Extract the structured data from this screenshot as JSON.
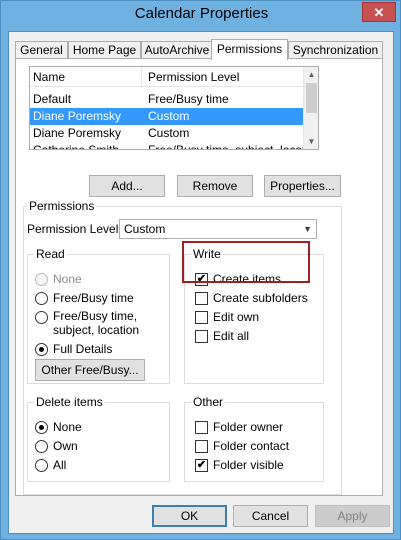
{
  "window": {
    "title": "Calendar Properties",
    "close_glyph": "✕"
  },
  "tabs": [
    "General",
    "Home Page",
    "AutoArchive",
    "Permissions",
    "Synchronization"
  ],
  "active_tab": "Permissions",
  "list": {
    "columns": [
      "Name",
      "Permission Level"
    ],
    "rows": [
      {
        "name": "Default",
        "level": "Free/Busy time"
      },
      {
        "name": "Diane Poremsky",
        "level": "Custom",
        "selected": true
      },
      {
        "name": "Diane Poremsky",
        "level": "Custom"
      },
      {
        "name": "Catherine Smith",
        "level": "Free/Busy time, subject, location"
      }
    ]
  },
  "list_buttons": {
    "add": "Add...",
    "remove": "Remove",
    "properties": "Properties..."
  },
  "permissions": {
    "group_label": "Permissions",
    "level_label": "Permission Level:",
    "level_value": "Custom",
    "read": {
      "label": "Read",
      "options": [
        "None",
        "Free/Busy time",
        "Free/Busy time,",
        "subject, location",
        "Full Details"
      ],
      "selected": "Full Details",
      "other_button": "Other Free/Busy..."
    },
    "write": {
      "label": "Write",
      "items": [
        {
          "label": "Create items",
          "checked": true
        },
        {
          "label": "Create subfolders",
          "checked": false
        },
        {
          "label": "Edit own",
          "checked": false
        },
        {
          "label": "Edit all",
          "checked": false
        }
      ]
    },
    "delete": {
      "label": "Delete items",
      "options": [
        "None",
        "Own",
        "All"
      ],
      "selected": "None"
    },
    "other": {
      "label": "Other",
      "items": [
        {
          "label": "Folder owner",
          "checked": false
        },
        {
          "label": "Folder contact",
          "checked": false
        },
        {
          "label": "Folder visible",
          "checked": true
        }
      ]
    }
  },
  "footer": {
    "ok": "OK",
    "cancel": "Cancel",
    "apply": "Apply"
  },
  "check_glyph": "✔",
  "colors": {
    "selection": "#3399ff",
    "highlight_box": "#a02020"
  },
  "icons": {
    "dropdown": "chevron-down-icon",
    "scroll_up": "arrow-up-icon",
    "scroll_down": "arrow-down-icon"
  }
}
